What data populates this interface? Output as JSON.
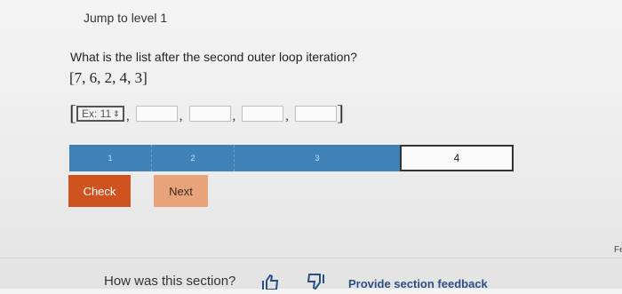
{
  "header": {
    "jump_label": "Jump to level 1"
  },
  "question": {
    "text": "What is the list after the second outer loop iteration?",
    "list": "[7, 6, 2, 4, 3]"
  },
  "answer": {
    "open_bracket": "[",
    "close_bracket": "]",
    "comma": ",",
    "first_placeholder": "Ex: 11",
    "spinner": "⇕"
  },
  "progress": {
    "levels": [
      "1",
      "2",
      "3",
      "4"
    ],
    "current": "4",
    "completed_fraction": 0.75
  },
  "buttons": {
    "check_label": "Check",
    "next_label": "Next"
  },
  "footer": {
    "edge_text": "Fe",
    "prompt": "How was this section?",
    "feedback_link": "Provide section feedback"
  },
  "colors": {
    "progress_blue": "#3f82b8",
    "check_orange": "#d0531f",
    "next_orange": "#e8a37a",
    "link_blue": "#2a4f83"
  }
}
